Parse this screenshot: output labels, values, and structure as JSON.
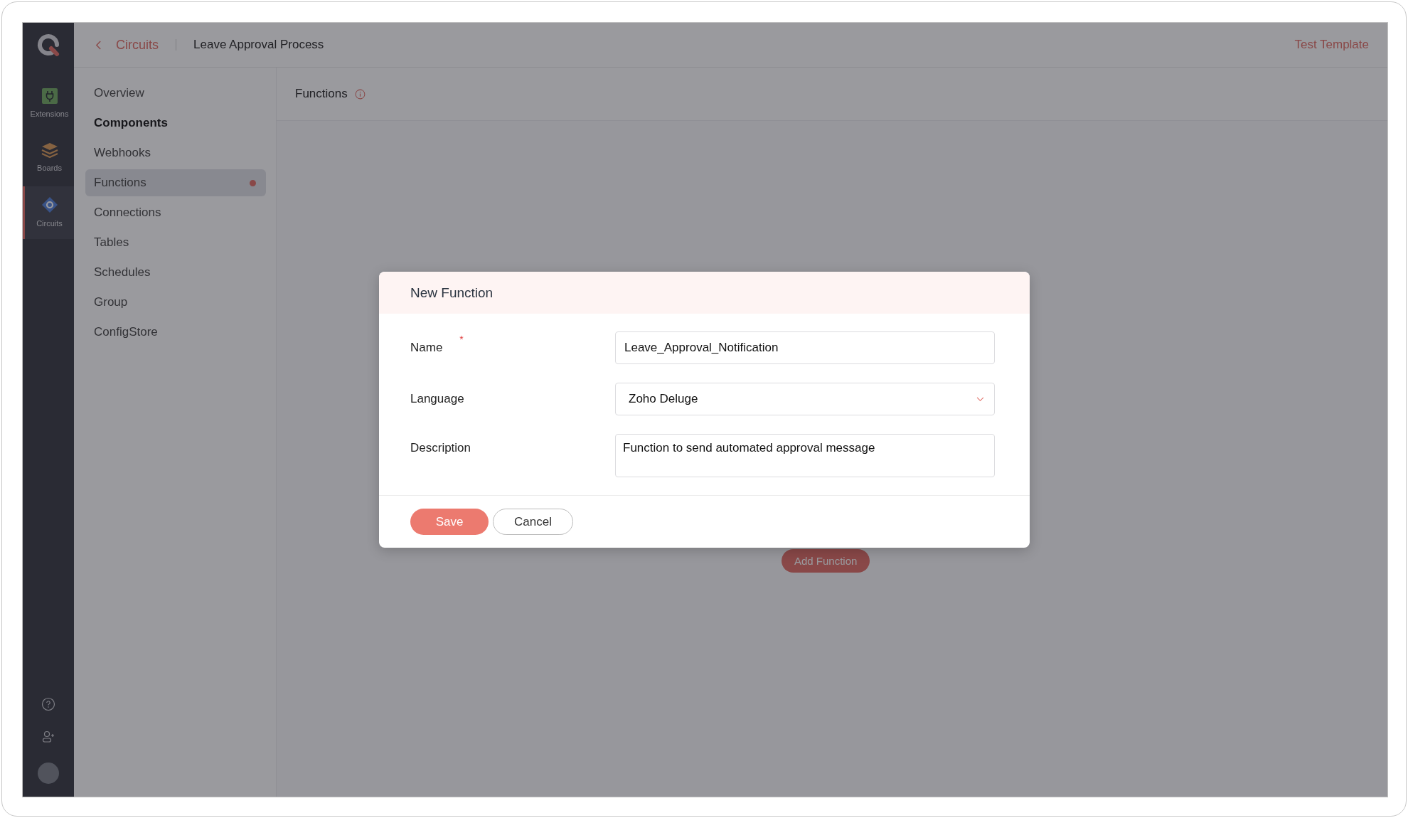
{
  "app_rail": {
    "items": [
      {
        "label": "Extensions",
        "selected": false
      },
      {
        "label": "Boards",
        "selected": false
      },
      {
        "label": "Circuits",
        "selected": true
      }
    ]
  },
  "breadcrumb": {
    "back_link": "Circuits",
    "current": "Leave Approval Process"
  },
  "header_link": "Test Template",
  "nav": {
    "items": [
      {
        "label": "Overview",
        "kind": "link",
        "selected": false,
        "has_dot": false
      },
      {
        "label": "Components",
        "kind": "heading"
      },
      {
        "label": "Webhooks",
        "kind": "link",
        "selected": false,
        "has_dot": false
      },
      {
        "label": "Functions",
        "kind": "link",
        "selected": true,
        "has_dot": true
      },
      {
        "label": "Connections",
        "kind": "link",
        "selected": false,
        "has_dot": false
      },
      {
        "label": "Tables",
        "kind": "link",
        "selected": false,
        "has_dot": false
      },
      {
        "label": "Schedules",
        "kind": "link",
        "selected": false,
        "has_dot": false
      },
      {
        "label": "Group",
        "kind": "link",
        "selected": false,
        "has_dot": false
      },
      {
        "label": "ConfigStore",
        "kind": "link",
        "selected": false,
        "has_dot": false
      }
    ]
  },
  "content": {
    "title": "Functions",
    "add_button": "Add Function"
  },
  "dialog": {
    "title": "New Function",
    "fields": [
      {
        "label": "Name",
        "kind": "text",
        "value": "Leave_Approval_Notification",
        "required_mark": "*"
      },
      {
        "label": "Language",
        "kind": "select",
        "value": "Zoho Deluge"
      },
      {
        "label": "Description",
        "kind": "textarea",
        "value": "Function to send automated approval message"
      }
    ],
    "buttons": [
      {
        "label": "Save",
        "kind": "primary"
      },
      {
        "label": "Cancel",
        "kind": "secondary"
      }
    ]
  }
}
